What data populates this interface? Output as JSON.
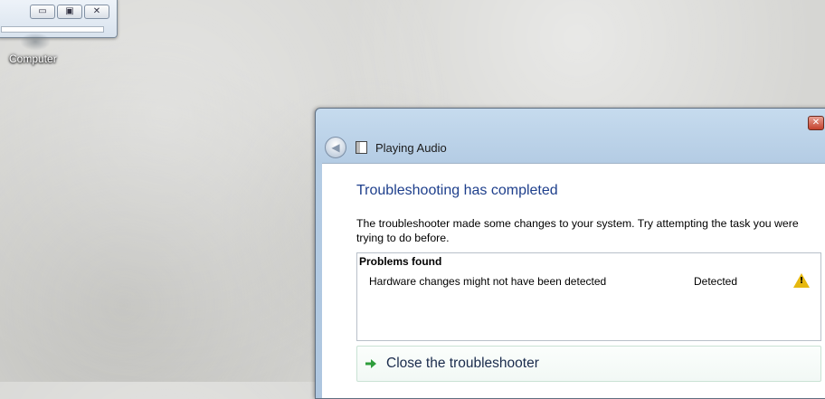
{
  "desktop": {
    "icon_label": "Computer",
    "icon_name": "computer-icon"
  },
  "mini_window": {
    "controls": {
      "minimize_glyph": "▭",
      "maximize_glyph": "▣",
      "close_glyph": "✕"
    }
  },
  "window": {
    "close_glyph": "✕",
    "nav": {
      "title": "Playing Audio",
      "back_icon": "back-arrow-icon",
      "app_icon": "troubleshooter-icon"
    },
    "heading": "Troubleshooting has completed",
    "description": "The troubleshooter made some changes to your system. Try attempting the task you were trying to do before.",
    "problems": {
      "header": "Problems found",
      "rows": [
        {
          "name": "Hardware changes might not have been detected",
          "status": "Detected",
          "icon": "warning-icon"
        }
      ]
    },
    "close_link": {
      "label": "Close the troubleshooter",
      "icon": "green-arrow-icon"
    }
  },
  "colors": {
    "heading": "#1e3f8c",
    "warning": "#e6b80f",
    "arrow": "#2e9d3c",
    "titlebar": "#b4cce4"
  }
}
